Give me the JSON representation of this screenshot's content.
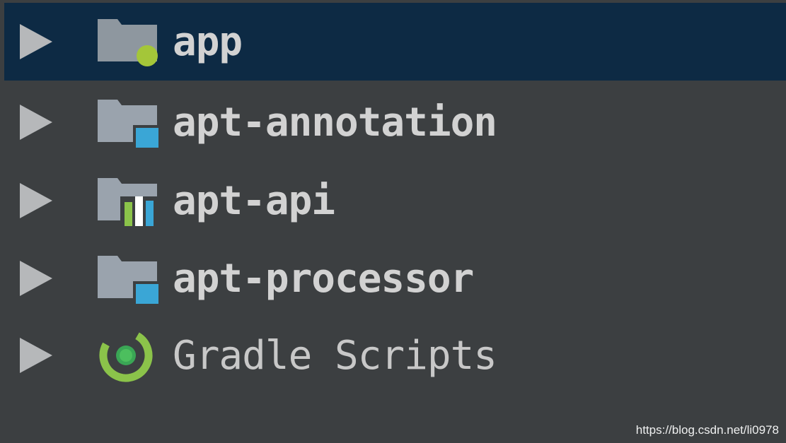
{
  "tree": {
    "items": [
      {
        "label": "app",
        "icon": "android-module-folder-icon",
        "selected": true
      },
      {
        "label": "apt-annotation",
        "icon": "java-module-folder-icon",
        "selected": false
      },
      {
        "label": "apt-api",
        "icon": "library-module-folder-icon",
        "selected": false
      },
      {
        "label": "apt-processor",
        "icon": "java-module-folder-icon",
        "selected": false
      },
      {
        "label": "Gradle Scripts",
        "icon": "gradle-icon",
        "selected": false
      }
    ]
  },
  "watermark": "https://blog.csdn.net/li0978",
  "colors": {
    "background": "#3c3f41",
    "selection": "#0d2a44",
    "folder": "#9aa3ad",
    "android_green": "#a4c639",
    "module_blue": "#3aa6d6",
    "gradle_green": "#8bc34a",
    "arrow": "#b6b8ba",
    "text": "#d2d2d2"
  }
}
